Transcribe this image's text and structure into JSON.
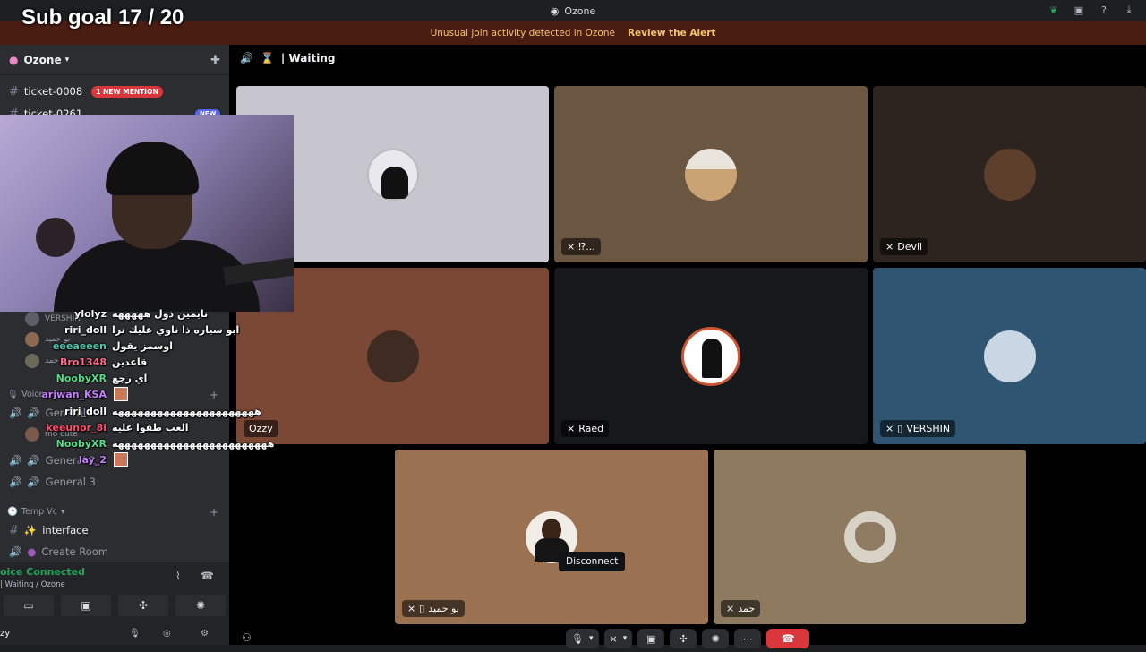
{
  "subgoal": "Sub goal 17 / 20",
  "window": {
    "title": "Ozone"
  },
  "alert": {
    "text": "Unusual join activity detected in Ozone",
    "action": "Review the Alert"
  },
  "server": {
    "name": "Ozone"
  },
  "channels": {
    "ticket1": {
      "name": "ticket-0008",
      "badge": "1 NEW MENTION"
    },
    "ticket2": {
      "name": "ticket-0261",
      "badge": "NEW"
    },
    "voice_category": "Voice",
    "general2": "General",
    "general2b": "General 2",
    "general3": "General 3",
    "temp_category": "Temp Vc",
    "interface": "interface",
    "create_room": "Create Room"
  },
  "voice_members": [
    "VERSHIN",
    "بو حميد",
    "حمد",
    "mo cute"
  ],
  "chat": [
    {
      "name": "ylolyz",
      "color": "#ffffff",
      "msg": "نايمين ذول هههههه"
    },
    {
      "name": "riri_doll",
      "color": "#ffffff",
      "msg": "ابو سياره ذا ناوي عليك ترا"
    },
    {
      "name": "eeeaeeen",
      "color": "#4ec9b0",
      "msg": "اوسمز يقول"
    },
    {
      "name": "Bro1348",
      "color": "#ff6b8a",
      "msg": "قاعدين"
    },
    {
      "name": "NoobyXR",
      "color": "#4ee08a",
      "msg": "اي رجع"
    },
    {
      "name": "arjwan_KSA",
      "color": "#c77dff",
      "msg": ""
    },
    {
      "name": "riri_doll",
      "color": "#ffffff",
      "msg": "ههههههههههههههههههههههه"
    },
    {
      "name": "keeunor_8i",
      "color": "#ff4d6d",
      "msg": "العب طفوا عليه"
    },
    {
      "name": "NoobyXR",
      "color": "#4ee08a",
      "msg": "ههههههههههههههههههههههههه"
    },
    {
      "name": "lay_2",
      "color": "#c77dff",
      "msg": ""
    }
  ],
  "voice_panel": {
    "status": "oice Connected",
    "sub": "| Waiting / Ozone",
    "user": "zy"
  },
  "stage": {
    "channel": "Waiting"
  },
  "tiles": {
    "t1": {
      "label": "★"
    },
    "t2": {
      "label": "‎⁉..."
    },
    "t3": {
      "label": "Devil"
    },
    "t4": {
      "label": "Ozzy"
    },
    "t5": {
      "label": "Raed"
    },
    "t6": {
      "label": "VERSHIN"
    },
    "t7": {
      "label": "بو حميد"
    },
    "t8": {
      "label": "حمد"
    }
  },
  "tooltip": "Disconnect",
  "colors": {
    "accent_red": "#da373c",
    "connected_green": "#23a55a",
    "alert_bg": "#4a1d12"
  }
}
